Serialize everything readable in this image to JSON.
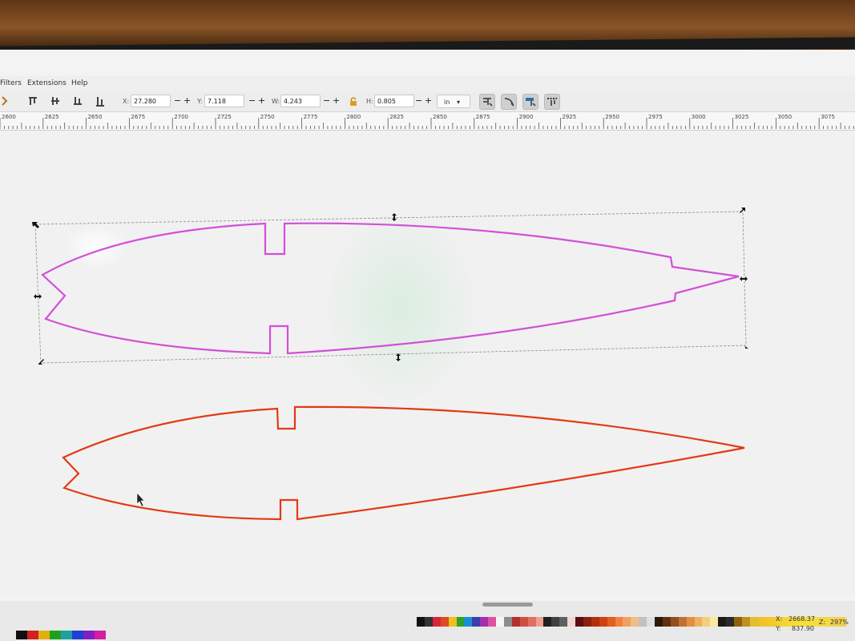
{
  "menu": {
    "items": [
      "Filters",
      "Extensions",
      "Help"
    ]
  },
  "toolbar": {
    "x_label": "X:",
    "x_value": "27.280",
    "y_label": "Y:",
    "y_value": "7.118",
    "w_label": "W:",
    "w_value": "4.243",
    "h_label": "H:",
    "h_value": "0.805",
    "minus": "−",
    "plus": "+",
    "unit": "in",
    "unit_caret": "▾",
    "lock_icon": "lock-icon"
  },
  "ruler": {
    "labels": [
      "2600",
      "2625",
      "2650",
      "2675",
      "2700",
      "2725",
      "2750",
      "2775",
      "2800",
      "2825",
      "2850",
      "2875",
      "2900",
      "2925",
      "2950",
      "2975",
      "3000",
      "3025",
      "3050",
      "3075"
    ]
  },
  "shapes": {
    "selected_color": "#d34fd8",
    "unselected_color": "#e23a14"
  },
  "palette": {
    "colors": [
      "#111111",
      "#333333",
      "#d6263a",
      "#e04a1f",
      "#f0c020",
      "#31a02c",
      "#1b8fd6",
      "#3d3fb0",
      "#a030b0",
      "#e050a0",
      "#f5f5f5",
      "#8c8c8c",
      "#b03030",
      "#d05040",
      "#e07060",
      "#f0a090",
      "#202020",
      "#404040",
      "#606060",
      "#f0d8d0",
      "#5a1010",
      "#8a2010",
      "#b03010",
      "#d04010",
      "#e06020",
      "#f08040",
      "#f0a060",
      "#f0c080",
      "#c0c0c0",
      "#e0e0e0",
      "#301808",
      "#603010",
      "#905020",
      "#c07030",
      "#e09040",
      "#f0b060",
      "#f0d080",
      "#f8e8a0",
      "#1a1a1a",
      "#2a2a2a",
      "#906010",
      "#c09020",
      "#e0c030"
    ],
    "colors2": [
      "#101010",
      "#d02020",
      "#e0b010",
      "#20a020",
      "#20a0a0",
      "#2040d0",
      "#8020c0",
      "#d020a0"
    ]
  },
  "status": {
    "x_label": "X:",
    "x_value": "2668.37",
    "y_label": "Y:",
    "y_value": "837.90",
    "z_label": "Z:",
    "zoom": "297%"
  }
}
